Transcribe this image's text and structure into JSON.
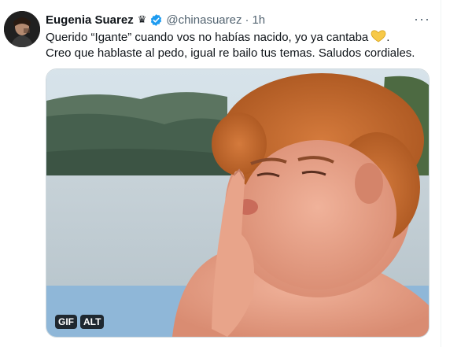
{
  "tweet": {
    "author": {
      "name": "Eugenia Suarez",
      "badge_icon": "crown-icon",
      "handle": "@chinasuarez"
    },
    "separator": "·",
    "time": "1h",
    "text_line1": "Querido “Igante” cuando vos no habías nacido, yo ya cantaba",
    "text_line1_end": ".",
    "text_line2": "Creo que hablaste al pedo, igual re bailo tus temas. Saludos cordiales.",
    "more_icon": "···",
    "media": {
      "gif_label": "GIF",
      "alt_label": "ALT"
    }
  },
  "colors": {
    "verified": "#1d9bf0",
    "secondary_text": "#536471",
    "heart": "#f7c948",
    "border": "#cfd9de"
  }
}
